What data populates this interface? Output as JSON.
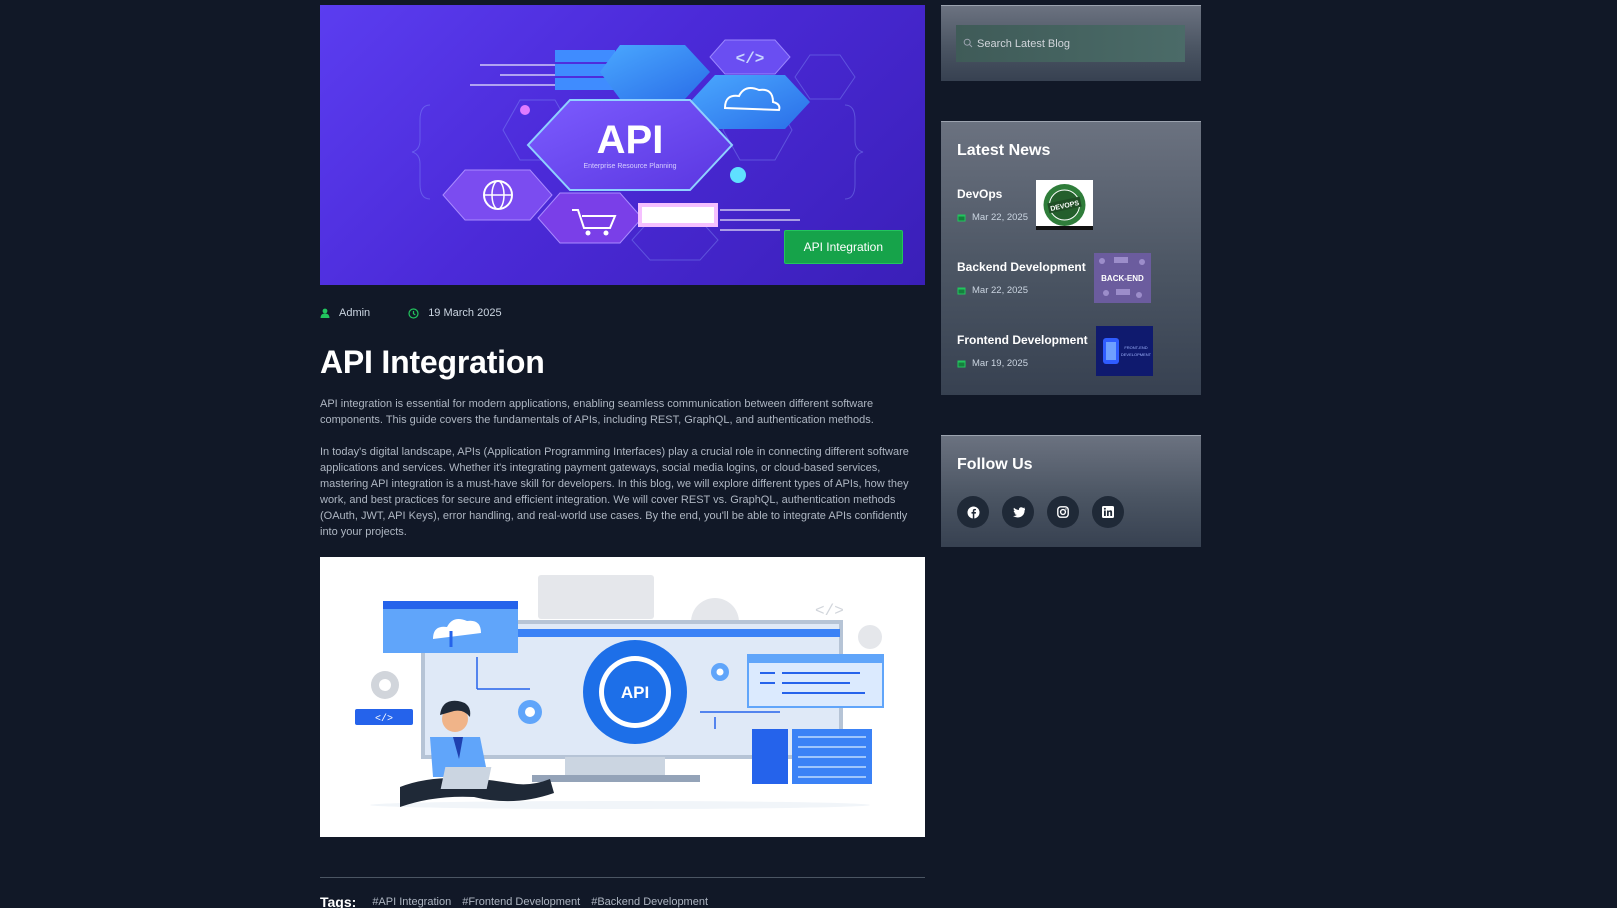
{
  "article": {
    "hero_badge": "API Integration",
    "hero_art_text": "API",
    "hero_art_subtext": "Enterprise Resource Planning",
    "author": "Admin",
    "date": "19 March 2025",
    "title": "API Integration",
    "intro": "API integration is essential for modern applications, enabling seamless communication between different software components. This guide covers the fundamentals of APIs, including REST, GraphQL, and authentication methods.",
    "body": "In today's digital landscape, APIs (Application Programming Interfaces) play a crucial role in connecting different software applications and services. Whether it's integrating payment gateways, social media logins, or cloud-based services, mastering API integration is a must-have skill for developers. In this blog, we will explore different types of APIs, how they work, and best practices for secure and efficient integration. We will cover REST vs. GraphQL, authentication methods (OAuth, JWT, API Keys), error handling, and real-world use cases. By the end, you'll be able to integrate APIs confidently into your projects.",
    "figure_art_text": "API",
    "figure_code_text": "</>",
    "tags_label": "Tags:",
    "tags": [
      "#API Integration",
      "#Frontend Development",
      "#Backend Development"
    ]
  },
  "sidebar": {
    "search_placeholder": "Search Latest Blog",
    "latest_news_title": "Latest News",
    "news": [
      {
        "title": "DevOps",
        "date": "Mar 22, 2025",
        "thumb_text": "DEVOPS"
      },
      {
        "title": "Backend Development",
        "date": "Mar 22, 2025",
        "thumb_text": "BACK-END"
      },
      {
        "title": "Frontend Development",
        "date": "Mar 19, 2025",
        "thumb_text": "FRONT-END DEVELOPMENT"
      }
    ],
    "follow_title": "Follow Us",
    "social": [
      "facebook-icon",
      "twitter-icon",
      "instagram-icon",
      "linkedin-icon"
    ]
  },
  "colors": {
    "background": "#111827",
    "accent_green": "#16a34a",
    "card_gray": "#4b5563",
    "hero_purple": "#4b2ad8"
  }
}
